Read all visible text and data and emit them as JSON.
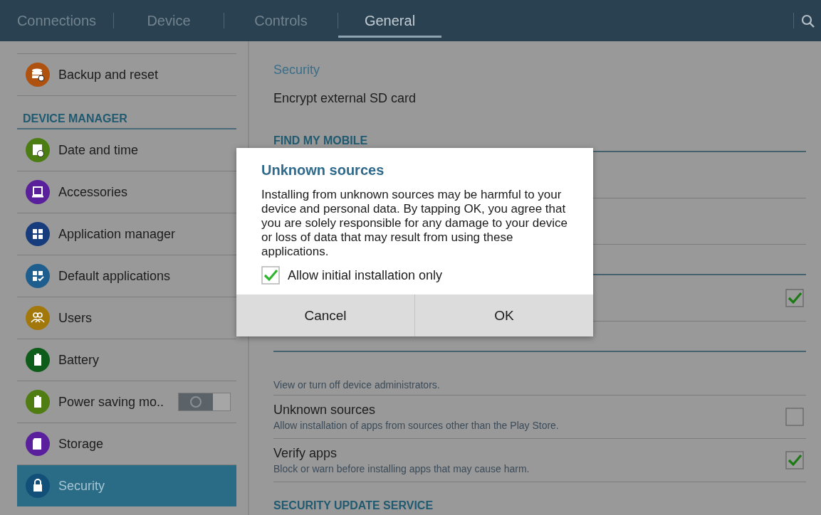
{
  "tabs": [
    {
      "label": "Connections",
      "selected": false
    },
    {
      "label": "Device",
      "selected": false
    },
    {
      "label": "Controls",
      "selected": false
    },
    {
      "label": "General",
      "selected": true
    }
  ],
  "sidebar": {
    "items": [
      {
        "kind": "item",
        "label": "Backup and reset",
        "color": "#b0520f",
        "selected": false
      },
      {
        "kind": "header",
        "label": "DEVICE MANAGER"
      },
      {
        "kind": "item",
        "label": "Date and time",
        "color": "#4c7d12",
        "selected": false
      },
      {
        "kind": "item",
        "label": "Accessories",
        "color": "#5a1f9a",
        "selected": false
      },
      {
        "kind": "item",
        "label": "Application manager",
        "color": "#173c7e",
        "selected": false
      },
      {
        "kind": "item",
        "label": "Default applications",
        "color": "#1d5e8f",
        "selected": false
      },
      {
        "kind": "item",
        "label": "Users",
        "color": "#a3780b",
        "selected": false
      },
      {
        "kind": "item",
        "label": "Battery",
        "color": "#0e5c1a",
        "selected": false
      },
      {
        "kind": "switch",
        "label": "Power saving mo..",
        "color": "#4f7d12",
        "selected": false,
        "on": false
      },
      {
        "kind": "item",
        "label": "Storage",
        "color": "#5a1f9c",
        "selected": false
      },
      {
        "kind": "item",
        "label": "Security",
        "color": "#12507a",
        "selected": true
      }
    ]
  },
  "content": {
    "items": [
      {
        "kind": "category",
        "label": "Security"
      },
      {
        "kind": "item",
        "title": "Encrypt external SD card"
      },
      {
        "kind": "header",
        "label": "FIND MY MOBILE"
      },
      {
        "kind": "covered"
      },
      {
        "kind": "covered"
      },
      {
        "kind": "covered_header"
      },
      {
        "kind": "covered",
        "checked": true
      },
      {
        "kind": "covered_header"
      },
      {
        "kind": "item",
        "subtitle": "View or turn off device administrators."
      },
      {
        "kind": "item",
        "title": "Unknown sources",
        "subtitle": "Allow installation of apps from sources other than the Play Store.",
        "checked": false
      },
      {
        "kind": "item",
        "title": "Verify apps",
        "subtitle": "Block or warn before installing apps that may cause harm.",
        "checked": true
      },
      {
        "kind": "header",
        "label": "SECURITY UPDATE SERVICE"
      }
    ]
  },
  "dialog": {
    "title": "Unknown sources",
    "message": "Installing from unknown sources may be harmful to your device and personal data. By tapping OK, you agree that you are solely responsible for any damage to your device or loss of data that may result from using these applications.",
    "checkbox": {
      "label": "Allow initial installation only",
      "checked": true
    },
    "buttons": [
      "Cancel",
      "OK"
    ]
  }
}
